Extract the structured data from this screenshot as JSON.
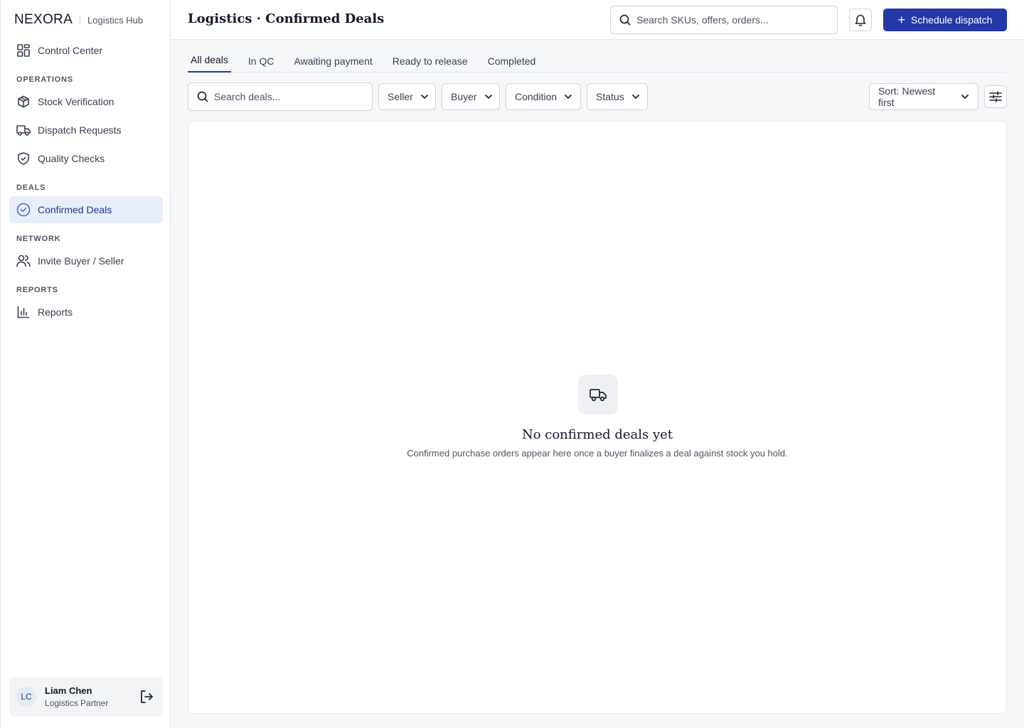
{
  "brand": {
    "name": "NEXORA",
    "subtitle": "Logistics Hub"
  },
  "sidebar": {
    "top_items": [
      {
        "label": "Control Center",
        "icon": "dashboard-icon"
      }
    ],
    "sections": [
      {
        "label": "OPERATIONS",
        "items": [
          {
            "label": "Stock Verification",
            "icon": "box-icon"
          },
          {
            "label": "Dispatch Requests",
            "icon": "truck-icon"
          },
          {
            "label": "Quality Checks",
            "icon": "shield-check-icon"
          }
        ]
      },
      {
        "label": "DEALS",
        "items": [
          {
            "label": "Confirmed Deals",
            "icon": "check-circle-icon",
            "active": true
          }
        ]
      },
      {
        "label": "NETWORK",
        "items": [
          {
            "label": "Invite Buyer / Seller",
            "icon": "users-icon"
          }
        ]
      },
      {
        "label": "REPORTS",
        "items": [
          {
            "label": "Reports",
            "icon": "bar-chart-icon"
          }
        ]
      }
    ]
  },
  "user": {
    "initials": "LC",
    "name": "Liam Chen",
    "role": "Logistics Partner"
  },
  "header": {
    "title": "Logistics · Confirmed Deals",
    "search_placeholder": "Search SKUs, offers, orders...",
    "primary_button": "Schedule dispatch"
  },
  "tabs": [
    {
      "label": "All deals",
      "active": true
    },
    {
      "label": "In QC"
    },
    {
      "label": "Awaiting payment"
    },
    {
      "label": "Ready to release"
    },
    {
      "label": "Completed"
    }
  ],
  "filters": {
    "search_placeholder": "Search deals...",
    "seller": "Seller",
    "buyer": "Buyer",
    "condition": "Condition",
    "status": "Status",
    "sort": "Sort: Newest first"
  },
  "empty_state": {
    "title": "No confirmed deals yet",
    "message": "Confirmed purchase orders appear here once a buyer finalizes a deal against stock you hold."
  },
  "colors": {
    "accent": "#2438a8",
    "active_nav_bg": "#e9eefb",
    "active_nav_text": "#1e3a8a"
  }
}
